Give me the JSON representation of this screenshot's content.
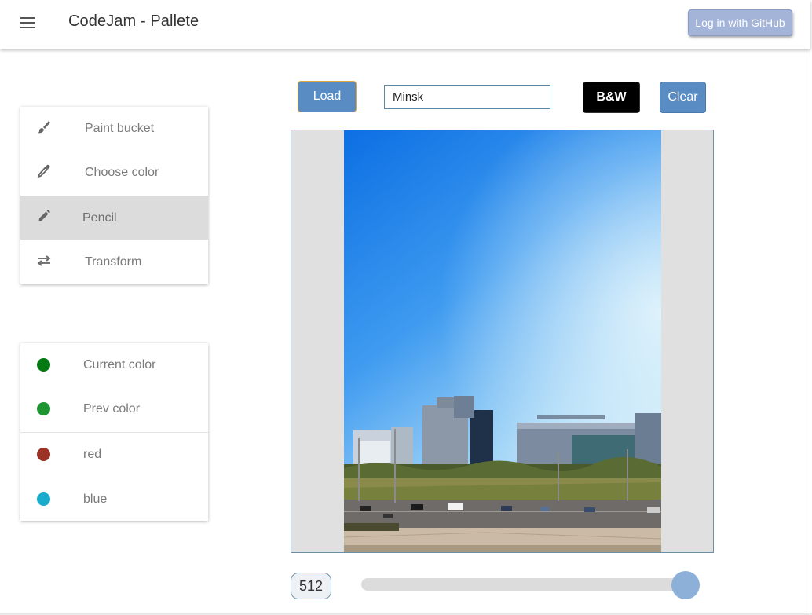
{
  "header": {
    "title": "CodeJam - Pallete",
    "login_label": "Log in with GitHub",
    "menu_icon": "hamburger-menu-icon"
  },
  "tools": {
    "items": [
      {
        "label": "Paint bucket",
        "icon": "brush-icon",
        "active": false
      },
      {
        "label": "Choose color",
        "icon": "eyedropper-icon",
        "active": false
      },
      {
        "label": "Pencil",
        "icon": "pencil-icon",
        "active": true
      },
      {
        "label": "Transform",
        "icon": "swap-arrows-icon",
        "active": false
      }
    ]
  },
  "colors": {
    "current": {
      "label": "Current color",
      "value": "#047a12"
    },
    "prev": {
      "label": "Prev color",
      "value": "#1e9632"
    },
    "presets": [
      {
        "label": "red",
        "value": "#9c3125"
      },
      {
        "label": "blue",
        "value": "#1aaccc"
      }
    ]
  },
  "toolbar": {
    "load_label": "Load",
    "town_value": "Minsk",
    "bw_label": "B&W",
    "clear_label": "Clear"
  },
  "canvas": {
    "image_description_icon": "city-photo",
    "size_value": "512"
  },
  "slider": {
    "value_fraction": 1.0
  },
  "theme": {
    "accent": "#5a8cc4",
    "github_button": "#a3b4d8",
    "active_tool_bg": "#dcdcdc"
  }
}
